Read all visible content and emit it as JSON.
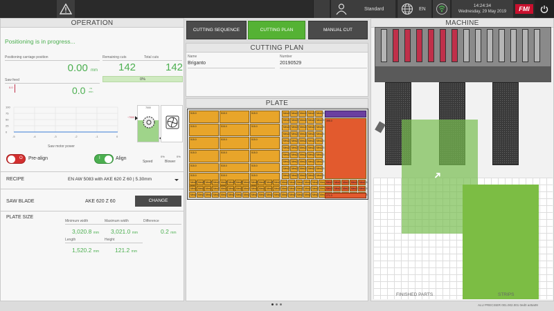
{
  "topbar": {
    "user": "Standard",
    "language": "EN",
    "time": "14:24:34",
    "date": "Wednesday, 29 May 2019",
    "logo": "FMI"
  },
  "operation": {
    "title": "OPERATION",
    "status": "Positioning is in progress...",
    "positioning_label": "Positioning carriage position",
    "positioning_value": "0.00",
    "positioning_unit": "mm",
    "remaining_label": "Remaining cuts",
    "remaining_value": "142",
    "total_label": "Total cuts",
    "total_value": "142",
    "progress_text": "0%",
    "progress_value": 0,
    "saw_feed_label": "Saw feed",
    "saw_feed_marker": "0.0",
    "saw_feed_value": "0.0",
    "saw_feed_unit_top": "m",
    "saw_feed_unit_bottom": "min",
    "motor_power_label": "Saw motor power",
    "motor_y_ticks": [
      "100",
      "75",
      "50",
      "25",
      "0"
    ],
    "motor_x_ticks": [
      "-5",
      "-4",
      "-3",
      "-2",
      "-1",
      "0"
    ],
    "speed_label": "Speed",
    "speed_top": "7000",
    "speed_marker": "~7000",
    "blower_label": "Blower",
    "blower_left": "0%",
    "blower_right": "0%",
    "prealign_label": "Pre-align",
    "prealign_state": "O",
    "align_label": "Align",
    "align_state": "I",
    "recipe_label": "RECIPE",
    "recipe_value": "EN AW 5083 with AKE 620 Z 60 | 5.30mm",
    "saw_blade_label": "SAW BLADE",
    "saw_blade_value": "AKE 620 Z 60",
    "change_button": "CHANGE",
    "plate_size_label": "PLATE SIZE",
    "min_width_label": "Minimum width",
    "min_width_value": "3,020.8",
    "max_width_label": "Maximum width",
    "max_width_value": "3,021.0",
    "difference_label": "Difference",
    "difference_value": "0.2",
    "length_label": "Length",
    "length_value": "1,520.2",
    "height_label": "Height",
    "height_value": "121.2",
    "unit_mm": "mm"
  },
  "tabs": {
    "cutting_sequence": "CUTTING SEQUENCE",
    "cutting_plan": "CUTTING PLAN",
    "manual_cut": "MANUAL CUT"
  },
  "cutting_plan": {
    "title": "CUTTING PLAN",
    "name_label": "Name",
    "name_value": "Briganto",
    "number_label": "Number",
    "number_value": "20190529"
  },
  "plate": {
    "title": "PLATE",
    "piece_large": "515.0",
    "piece_small": "Mes2.5",
    "piece_right": "395.0",
    "piece_bottom": "271.0"
  },
  "machine": {
    "title": "MACHINE",
    "finished_parts": "FINISHED PARTS",
    "strips": "STRIPS"
  },
  "footer": {
    "version": "ALU PRECISER 001.002.001 0ed0 a45a09"
  },
  "colors": {
    "accent_green": "#4caf50",
    "tab_active": "#55b234",
    "piece_orange": "#e8a52a",
    "remnant_red": "#e25a2e",
    "clamp_red": "#c0304a"
  }
}
